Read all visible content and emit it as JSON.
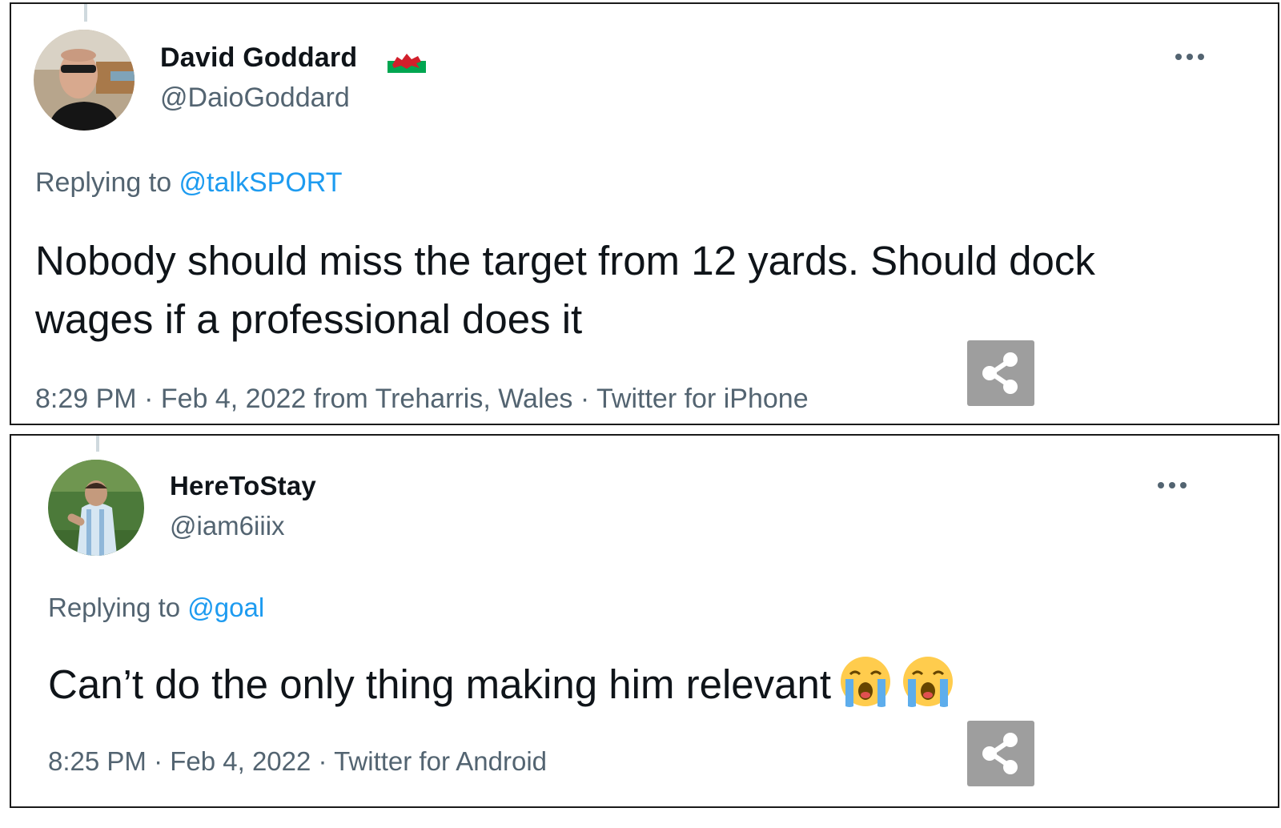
{
  "tweets": [
    {
      "display_name": "David Goddard",
      "flag_icon": "wales-flag-icon",
      "handle": "@DaioGoddard",
      "replying_prefix": "Replying to ",
      "replying_to": "@talkSPORT",
      "text": "Nobody should miss the target from 12 yards. Should dock wages if a professional does it",
      "meta": "8:29 PM · Feb 4, 2022 from Treharris, Wales · Twitter for iPhone",
      "more_icon": "more-options-icon",
      "share_icon": "share-icon"
    },
    {
      "display_name": "HereToStay",
      "handle": "@iam6iiix",
      "replying_prefix": "Replying to ",
      "replying_to": "@goal",
      "text": "Can’t do the only thing making him relevant",
      "emoji": [
        "loudly-crying-face-icon",
        "loudly-crying-face-icon"
      ],
      "meta": "8:25 PM · Feb 4, 2022 · Twitter for Android",
      "more_icon": "more-options-icon",
      "share_icon": "share-icon"
    }
  ],
  "colors": {
    "text": "#0f1419",
    "secondary": "#536471",
    "link": "#1d9bf0",
    "share_button": "#9e9e9e",
    "border": "#1a1a1a"
  }
}
